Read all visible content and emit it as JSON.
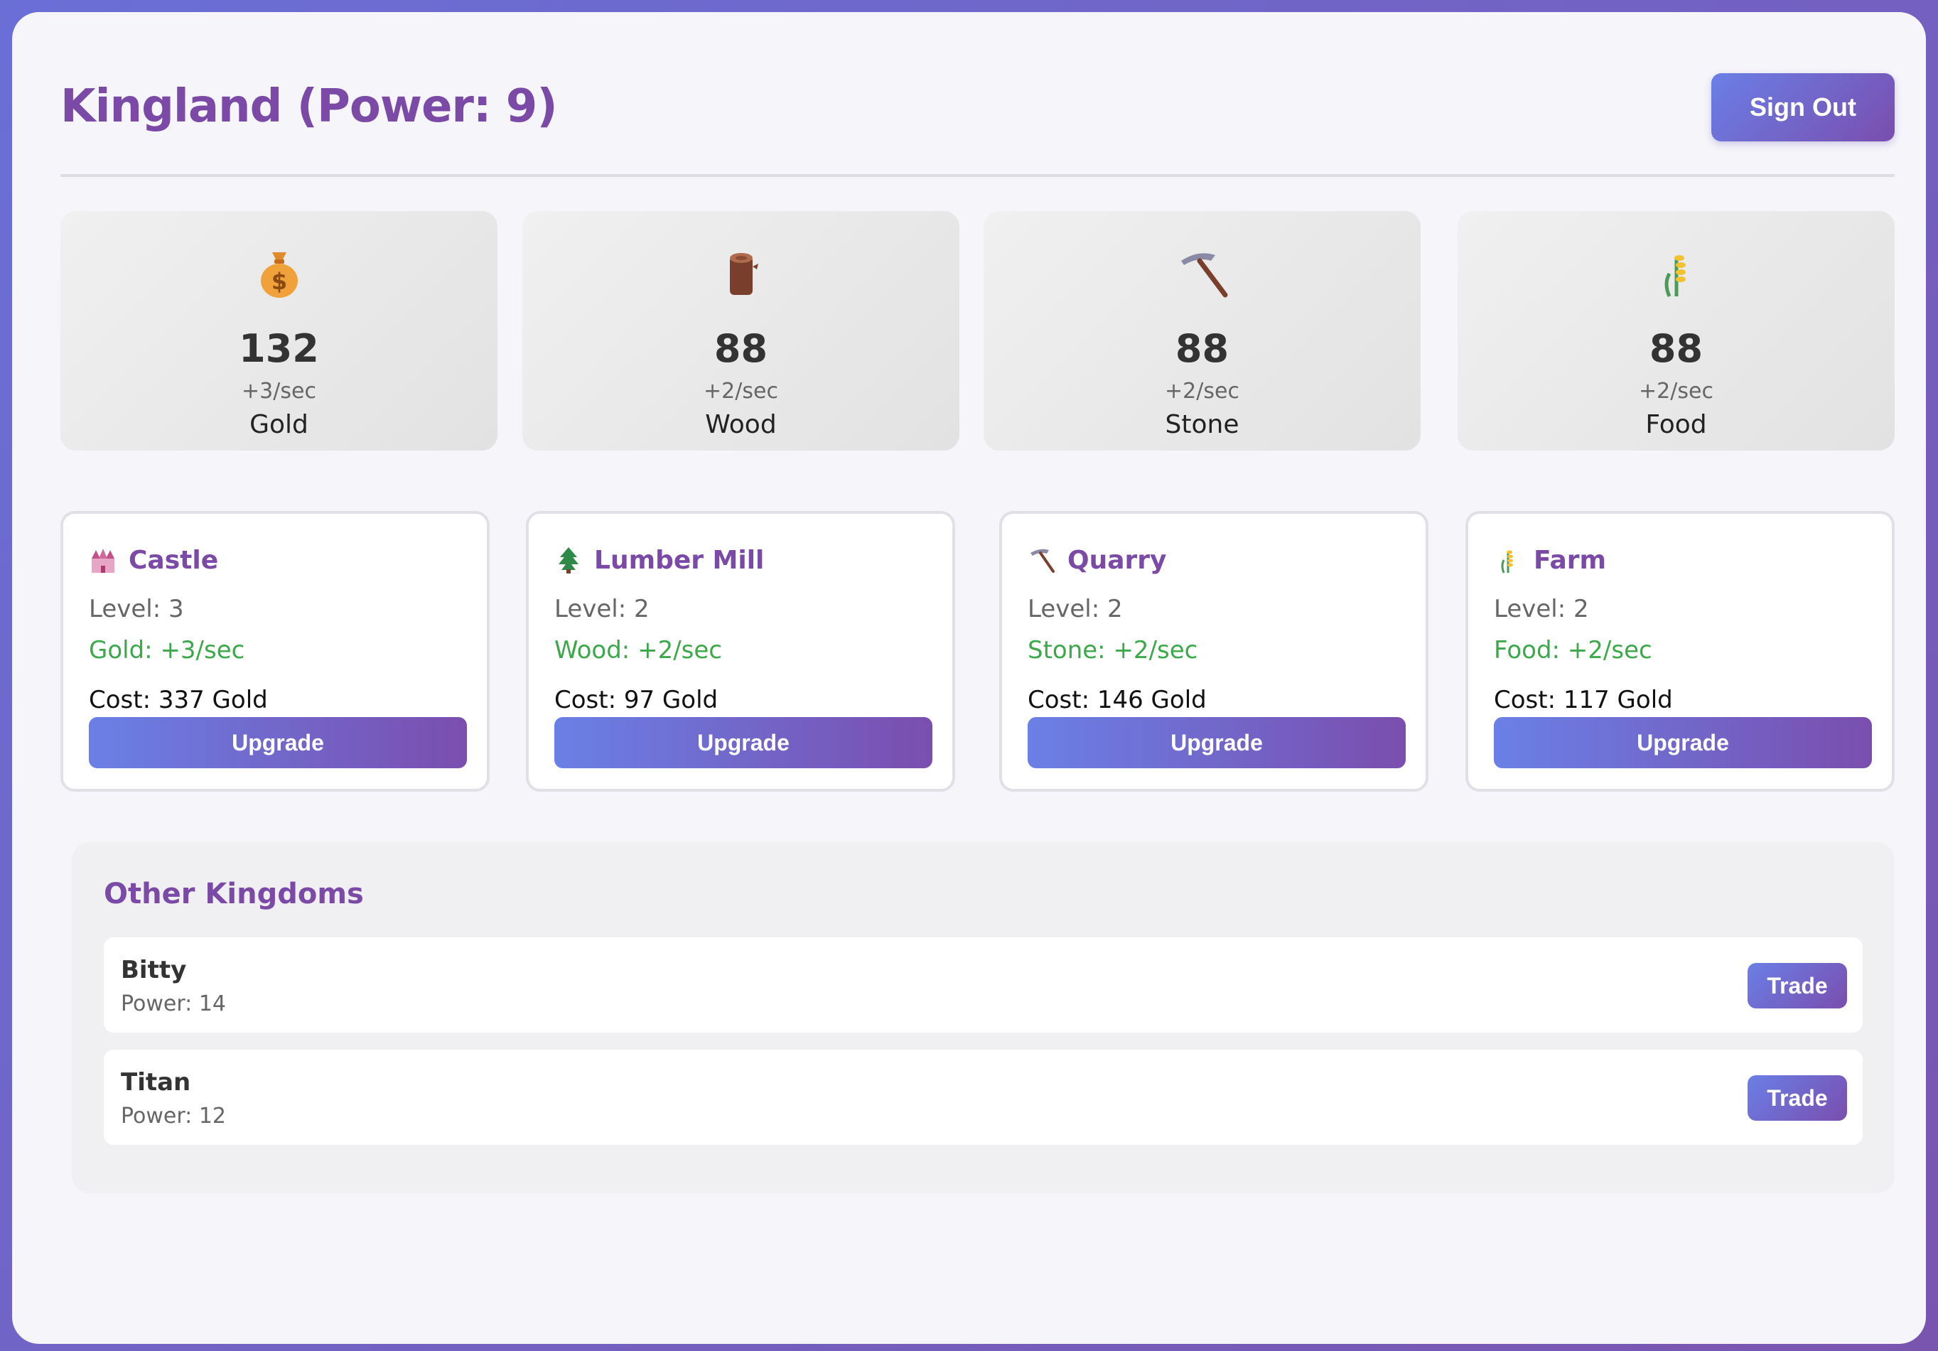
{
  "header": {
    "title": "Kingland (Power: 9)",
    "signout_label": "Sign Out"
  },
  "resources": [
    {
      "icon": "money-bag-icon",
      "amount": "132",
      "rate": "+3/sec",
      "name": "Gold"
    },
    {
      "icon": "wood-log-icon",
      "amount": "88",
      "rate": "+2/sec",
      "name": "Wood"
    },
    {
      "icon": "pickaxe-icon",
      "amount": "88",
      "rate": "+2/sec",
      "name": "Stone"
    },
    {
      "icon": "wheat-icon",
      "amount": "88",
      "rate": "+2/sec",
      "name": "Food"
    }
  ],
  "buildings": [
    {
      "icon": "castle-icon",
      "name": "Castle",
      "level": "Level: 3",
      "production": "Gold: +3/sec",
      "cost": "Cost: 337 Gold",
      "upgrade_label": "Upgrade"
    },
    {
      "icon": "tree-icon",
      "name": "Lumber Mill",
      "level": "Level: 2",
      "production": "Wood: +2/sec",
      "cost": "Cost: 97 Gold",
      "upgrade_label": "Upgrade"
    },
    {
      "icon": "pickaxe-icon",
      "name": "Quarry",
      "level": "Level: 2",
      "production": "Stone: +2/sec",
      "cost": "Cost: 146 Gold",
      "upgrade_label": "Upgrade"
    },
    {
      "icon": "wheat-icon",
      "name": "Farm",
      "level": "Level: 2",
      "production": "Food: +2/sec",
      "cost": "Cost: 117 Gold",
      "upgrade_label": "Upgrade"
    }
  ],
  "other_kingdoms": {
    "title": "Other Kingdoms",
    "list": [
      {
        "name": "Bitty",
        "power": "Power: 14",
        "trade_label": "Trade"
      },
      {
        "name": "Titan",
        "power": "Power: 12",
        "trade_label": "Trade"
      }
    ]
  },
  "colors": {
    "accent": "#7a4aa6",
    "gradient_start": "#6a80e6",
    "gradient_end": "#7a4eae",
    "production_green": "#3ca84a"
  }
}
